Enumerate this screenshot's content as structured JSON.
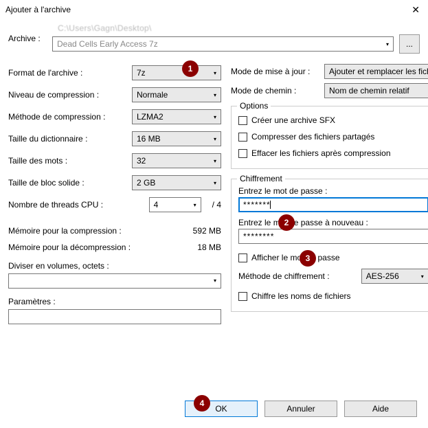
{
  "window": {
    "title": "Ajouter à l'archive"
  },
  "archive": {
    "label": "Archive :",
    "path_blur": "C:\\Users\\Gagn\\Desktop\\",
    "name_blur": "Dead Cells Early Access 7z",
    "browse": "..."
  },
  "left": {
    "format_label": "Format de l'archive :",
    "format_value": "7z",
    "level_label": "Niveau de compression :",
    "level_value": "Normale",
    "method_label": "Méthode de compression :",
    "method_value": "LZMA2",
    "dict_label": "Taille du dictionnaire :",
    "dict_value": "16 MB",
    "word_label": "Taille des mots :",
    "word_value": "32",
    "block_label": "Taille de bloc solide :",
    "block_value": "2 GB",
    "threads_label": "Nombre de threads CPU :",
    "threads_value": "4",
    "threads_total": "/ 4",
    "mem_comp_label": "Mémoire pour la compression :",
    "mem_comp_value": "592 MB",
    "mem_decomp_label": "Mémoire pour la décompression :",
    "mem_decomp_value": "18 MB",
    "volumes_label": "Diviser en volumes, octets :",
    "params_label": "Paramètres :"
  },
  "right": {
    "update_label": "Mode de mise à jour :",
    "update_value": "Ajouter et remplacer les fich",
    "path_label": "Mode de chemin :",
    "path_value": "Nom de chemin relatif",
    "options_legend": "Options",
    "opt_sfx": "Créer une archive SFX",
    "opt_shared": "Compresser des fichiers partagés",
    "opt_delete": "Effacer les fichiers après compression",
    "enc_legend": "Chiffrement",
    "pwd_label": "Entrez le mot de passe :",
    "pwd_value": "*******",
    "pwd2_label": "Entrez le mot de passe à nouveau :",
    "pwd2_value": "********",
    "show_pwd": "Afficher le mot de passe",
    "enc_method_label": "Méthode de chiffrement :",
    "enc_method_value": "AES-256",
    "enc_names": "Chiffre les noms de fichiers"
  },
  "buttons": {
    "ok": "OK",
    "cancel": "Annuler",
    "help": "Aide"
  },
  "markers": {
    "m1": "1",
    "m2": "2",
    "m3": "3",
    "m4": "4"
  }
}
